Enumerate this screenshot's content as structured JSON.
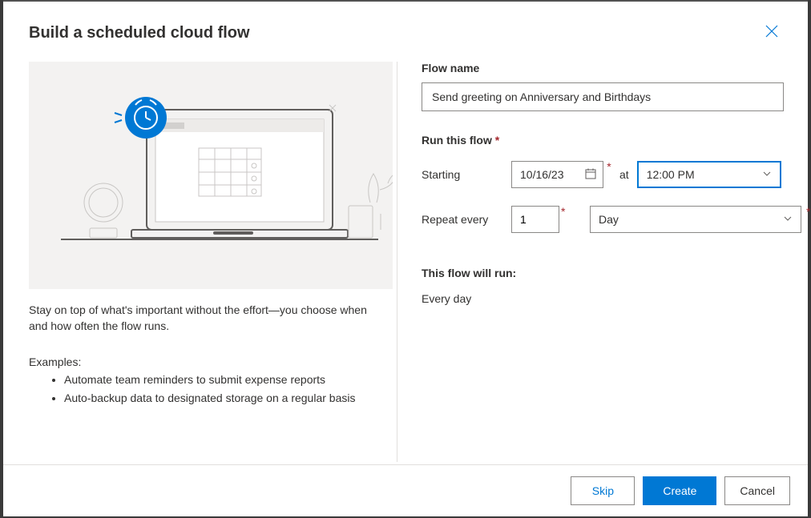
{
  "dialog": {
    "title": "Build a scheduled cloud flow",
    "description": "Stay on top of what's important without the effort—you choose when and how often the flow runs.",
    "examples_label": "Examples:",
    "examples": [
      "Automate team reminders to submit expense reports",
      "Auto-backup data to designated storage on a regular basis"
    ]
  },
  "form": {
    "flow_name_label": "Flow name",
    "flow_name_value": "Send greeting on Anniversary and Birthdays",
    "run_flow_label": "Run this flow",
    "starting_label": "Starting",
    "start_date": "10/16/23",
    "at_label": "at",
    "start_time": "12:00 PM",
    "repeat_label": "Repeat every",
    "repeat_count": "1",
    "repeat_unit": "Day",
    "will_run_label": "This flow will run:",
    "will_run_text": "Every day"
  },
  "buttons": {
    "skip": "Skip",
    "create": "Create",
    "cancel": "Cancel"
  }
}
